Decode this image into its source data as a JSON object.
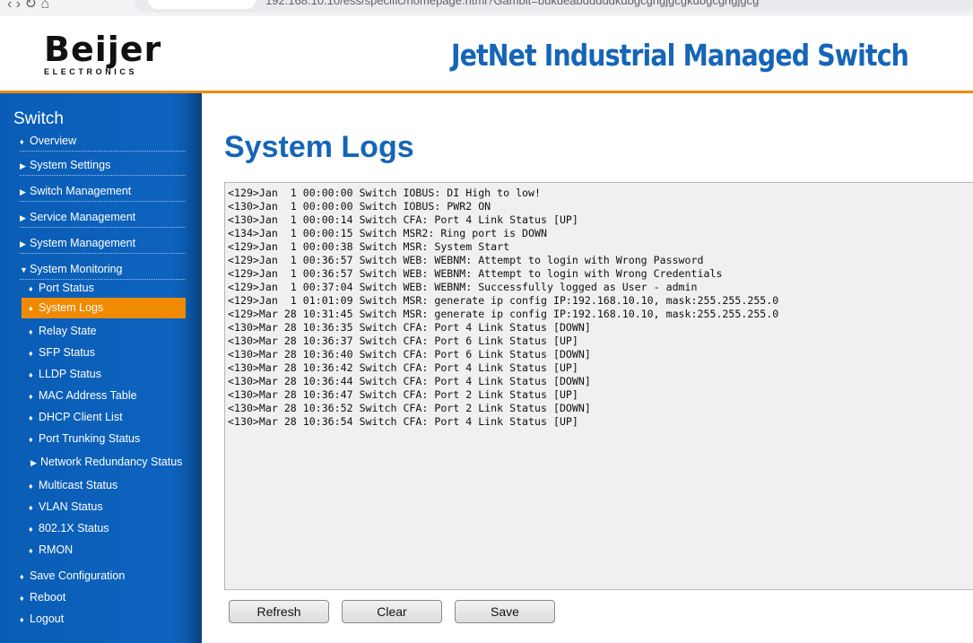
{
  "browser": {
    "url": "192.168.10.10/ess/specific/homepage.html?Gambit=bukdeabdddddkdbgcgngjgcgkdbgcgngjgcg"
  },
  "header": {
    "logo_brand": "Beijer",
    "logo_sub": "ELECTRONICS",
    "title": "JetNet Industrial Managed Switch",
    "accent_color": "#f08a00",
    "title_color": "#1565b8"
  },
  "sidebar": {
    "title": "Switch",
    "items": [
      {
        "label": "Overview",
        "mark": "bullet"
      },
      {
        "label": "System Settings",
        "mark": "arrow-right"
      },
      {
        "label": "Switch Management",
        "mark": "arrow-right"
      },
      {
        "label": "Service Management",
        "mark": "arrow-right"
      },
      {
        "label": "System Management",
        "mark": "arrow-right"
      },
      {
        "label": "System Monitoring",
        "mark": "arrow-down"
      }
    ],
    "monitoring_items": [
      {
        "label": "Port Status",
        "mark": "bullet"
      },
      {
        "label": "System Logs",
        "mark": "bullet",
        "active": true
      },
      {
        "label": "Relay State",
        "mark": "bullet"
      },
      {
        "label": "SFP Status",
        "mark": "bullet"
      },
      {
        "label": "LLDP Status",
        "mark": "bullet"
      },
      {
        "label": "MAC Address Table",
        "mark": "bullet"
      },
      {
        "label": "DHCP Client List",
        "mark": "bullet"
      },
      {
        "label": "Port Trunking Status",
        "mark": "bullet"
      },
      {
        "label": "Network Redundancy Status",
        "mark": "arrow-right"
      },
      {
        "label": "Multicast Status",
        "mark": "bullet"
      },
      {
        "label": "VLAN Status",
        "mark": "bullet"
      },
      {
        "label": "802.1X Status",
        "mark": "bullet"
      },
      {
        "label": "RMON",
        "mark": "bullet"
      }
    ],
    "bottom_items": [
      {
        "label": "Save Configuration",
        "mark": "bullet"
      },
      {
        "label": "Reboot",
        "mark": "bullet"
      },
      {
        "label": "Logout",
        "mark": "bullet"
      }
    ]
  },
  "main": {
    "page_title": "System Logs",
    "logs": [
      "<129>Jan  1 00:00:00 Switch IOBUS: DI High to low!",
      "<130>Jan  1 00:00:00 Switch IOBUS: PWR2 ON",
      "<130>Jan  1 00:00:14 Switch CFA: Port 4 Link Status [UP]",
      "<134>Jan  1 00:00:15 Switch MSR2: Ring port is DOWN",
      "<129>Jan  1 00:00:38 Switch MSR: System Start",
      "<129>Jan  1 00:36:57 Switch WEB: WEBNM: Attempt to login with Wrong Password",
      "<129>Jan  1 00:36:57 Switch WEB: WEBNM: Attempt to login with Wrong Credentials",
      "<129>Jan  1 00:37:04 Switch WEB: WEBNM: Successfully logged as User - admin",
      "<129>Jan  1 01:01:09 Switch MSR: generate ip config IP:192.168.10.10, mask:255.255.255.0",
      "<129>Mar 28 10:31:45 Switch MSR: generate ip config IP:192.168.10.10, mask:255.255.255.0",
      "<130>Mar 28 10:36:35 Switch CFA: Port 4 Link Status [DOWN]",
      "<130>Mar 28 10:36:37 Switch CFA: Port 6 Link Status [UP]",
      "<130>Mar 28 10:36:40 Switch CFA: Port 6 Link Status [DOWN]",
      "<130>Mar 28 10:36:42 Switch CFA: Port 4 Link Status [UP]",
      "<130>Mar 28 10:36:44 Switch CFA: Port 4 Link Status [DOWN]",
      "<130>Mar 28 10:36:47 Switch CFA: Port 2 Link Status [UP]",
      "<130>Mar 28 10:36:52 Switch CFA: Port 2 Link Status [DOWN]",
      "<130>Mar 28 10:36:54 Switch CFA: Port 4 Link Status [UP]"
    ],
    "buttons": {
      "refresh": "Refresh",
      "clear": "Clear",
      "save": "Save"
    }
  }
}
